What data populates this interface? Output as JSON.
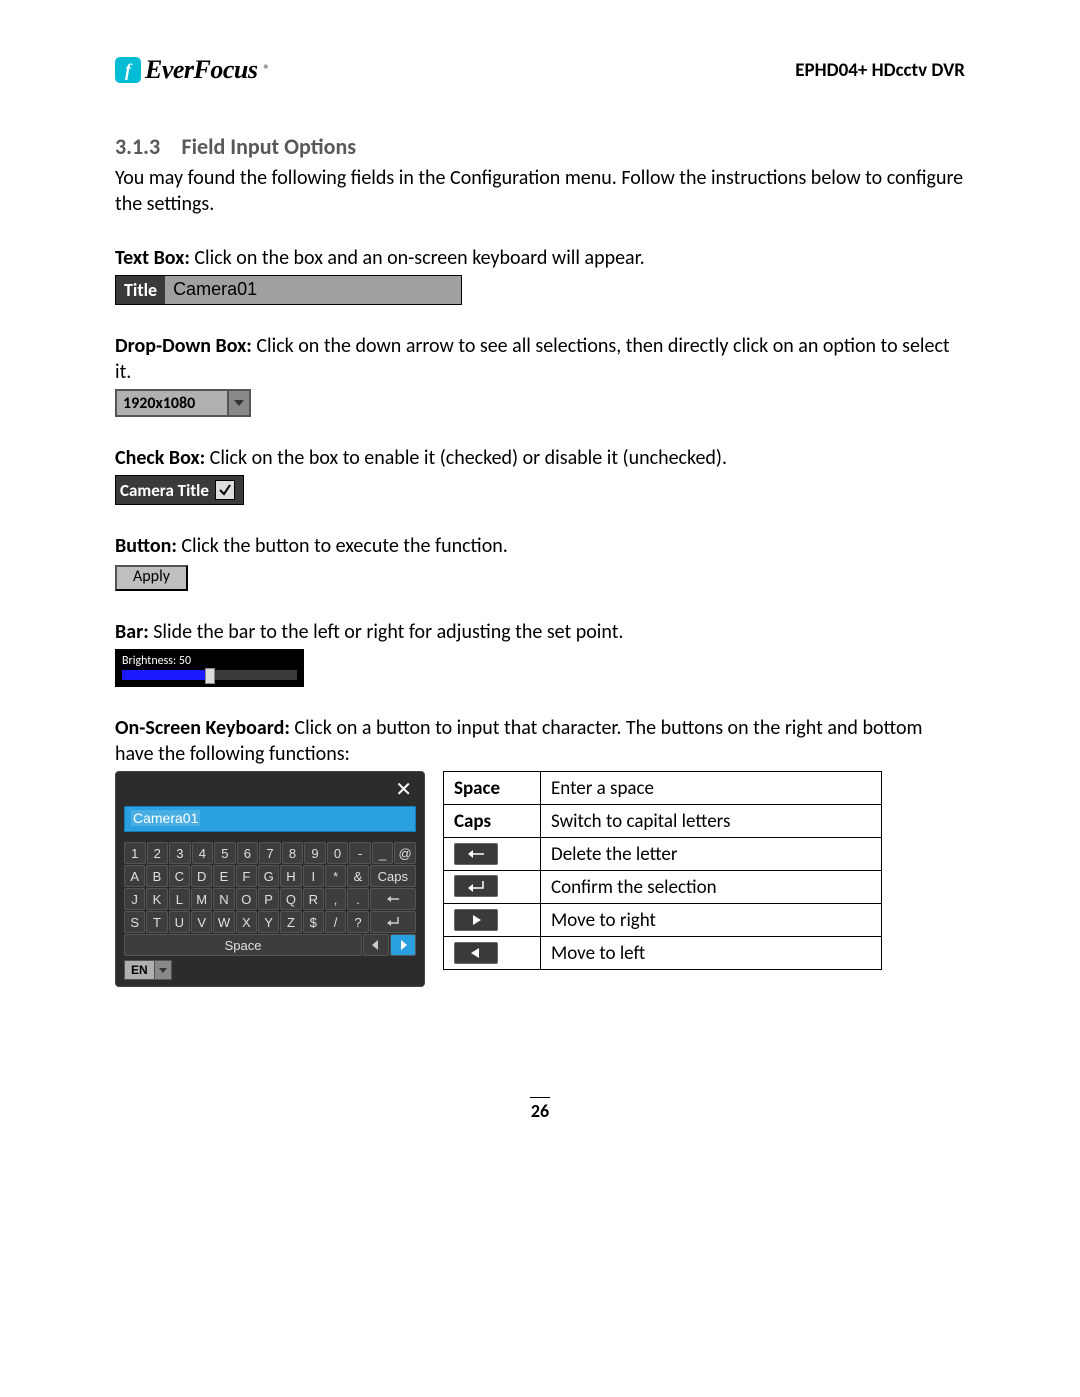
{
  "header": {
    "brand": "EverFocus",
    "doc_id": "EPHD04+  HDcctv DVR"
  },
  "section": {
    "number": "3.1.3",
    "title": "Field Input Options"
  },
  "intro": "You may found the following fields in the Configuration menu. Follow the instructions below to configure the settings.",
  "textbox": {
    "label": "Text Box:",
    "desc": " Click on the box and an on-screen keyboard will appear.",
    "field_label": "Title",
    "field_value": "Camera01"
  },
  "dropdown": {
    "label": "Drop-Down Box:",
    "desc": " Click on the down arrow to see all selections, then directly click on an option to select it.",
    "value": "1920x1080"
  },
  "checkbox": {
    "label": "Check Box:",
    "desc": " Click on the box to enable it (checked) or disable it (unchecked).",
    "field_label": "Camera Title"
  },
  "button": {
    "label": "Button:",
    "desc": " Click the button to execute the function.",
    "value": "Apply"
  },
  "bar": {
    "label": "Bar:",
    "desc": " Slide the bar to the left or right for adjusting the set point.",
    "text": "Brightness: 50"
  },
  "osk": {
    "label": "On-Screen Keyboard:",
    "desc": " Click on a button to input that character. The buttons on the right and bottom have the following functions:",
    "input_value": "Camera01",
    "rows": [
      [
        "1",
        "2",
        "3",
        "4",
        "5",
        "6",
        "7",
        "8",
        "9",
        "0",
        "-",
        "_",
        "@"
      ],
      [
        "A",
        "B",
        "C",
        "D",
        "E",
        "F",
        "G",
        "H",
        "I",
        "*",
        "&",
        "Caps"
      ],
      [
        "J",
        "K",
        "L",
        "M",
        "N",
        "O",
        "P",
        "Q",
        "R",
        ",",
        ".",
        "←"
      ],
      [
        "S",
        "T",
        "U",
        "V",
        "W",
        "X",
        "Y",
        "Z",
        "$",
        "/",
        "?",
        "↵"
      ]
    ],
    "space": "Space",
    "lang": "EN"
  },
  "legend": [
    {
      "key": "Space",
      "desc": "Enter a space",
      "type": "text"
    },
    {
      "key": "Caps",
      "desc": "Switch to capital letters",
      "type": "text"
    },
    {
      "key": "backspace",
      "desc": "Delete the letter",
      "type": "icon"
    },
    {
      "key": "enter",
      "desc": "Confirm the selection",
      "type": "icon"
    },
    {
      "key": "right",
      "desc": "Move to right",
      "type": "icon"
    },
    {
      "key": "left",
      "desc": "Move to left",
      "type": "icon"
    }
  ],
  "page_number": "26"
}
